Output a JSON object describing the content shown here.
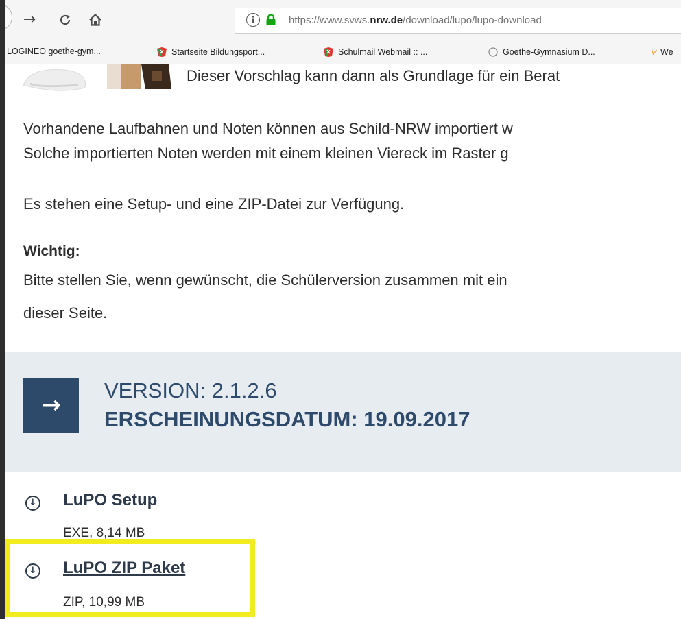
{
  "browser": {
    "url_prefix": "https://www.svws.",
    "url_domain": "nrw.de",
    "url_path": "/download/lupo/lupo-download",
    "bookmarks": [
      {
        "label": "LOGINEO goethe-gym...",
        "icon": "none"
      },
      {
        "label": "Startseite Bildungsport...",
        "icon": "nrw-logo-icon"
      },
      {
        "label": "Schulmail Webmail :: ...",
        "icon": "nrw-logo-icon"
      },
      {
        "label": "Goethe-Gymnasium D...",
        "icon": "globe-icon"
      },
      {
        "label": "We",
        "icon": "bookmark-icon"
      }
    ]
  },
  "page": {
    "intro_line": "Dieser Vorschlag kann dann als Grundlage für ein Berat",
    "para1_line1": "Vorhandene Laufbahnen und Noten können aus Schild-NRW importiert w",
    "para1_line2": "Solche importierten Noten werden mit einem kleinen Viereck im Raster g",
    "para2": "Es stehen eine Setup- und eine ZIP-Datei zur Verfügung.",
    "important_heading": "Wichtig:",
    "important_line1": "Bitte stellen Sie, wenn gewünscht, die Schülerversion zusammen mit ein",
    "important_line2": "dieser Seite.",
    "version_label": "VERSION: 2.1.2.6",
    "release_label": "ERSCHEINUNGSDATUM: 19.09.2017",
    "downloads": [
      {
        "title": "LuPO Setup",
        "meta": "EXE, 8,14 MB"
      },
      {
        "title": "LuPO ZIP Paket",
        "meta": "ZIP, 10,99 MB"
      }
    ]
  },
  "colors": {
    "accent": "#2e4a6b",
    "band": "#e7ecf1",
    "highlight": "#f2ec1f",
    "lock": "#12a312"
  }
}
